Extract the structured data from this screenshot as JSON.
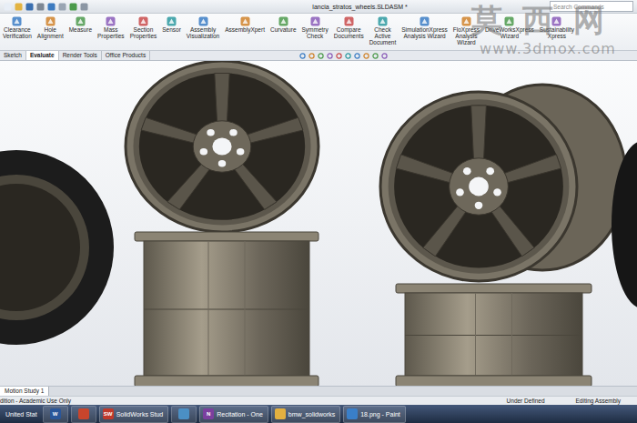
{
  "window": {
    "title": "lancia_stratos_wheels.SLDASM *"
  },
  "search": {
    "placeholder": "Search Commands"
  },
  "ribbon": [
    {
      "lines": [
        "Clearance",
        "Verification"
      ]
    },
    {
      "lines": [
        "Hole",
        "Alignment"
      ]
    },
    {
      "lines": [
        "Measure"
      ]
    },
    {
      "lines": [
        "Mass",
        "Properties"
      ]
    },
    {
      "lines": [
        "Section",
        "Properties"
      ]
    },
    {
      "lines": [
        "Sensor"
      ]
    },
    {
      "lines": [
        "Assembly",
        "Visualization"
      ]
    },
    {
      "lines": [
        "AssemblyXpert"
      ]
    },
    {
      "lines": [
        "Curvature"
      ]
    },
    {
      "lines": [
        "Symmetry",
        "Check"
      ]
    },
    {
      "lines": [
        "Compare",
        "Documents"
      ]
    },
    {
      "lines": [
        "Check",
        "Active",
        "Document"
      ]
    },
    {
      "lines": [
        "SimulationXpress",
        "Analysis Wizard"
      ]
    },
    {
      "lines": [
        "FloXpress",
        "Analysis",
        "Wizard"
      ]
    },
    {
      "lines": [
        "DriveWorksXpress",
        "Wizard"
      ]
    },
    {
      "lines": [
        "Sustainability",
        "Xpress"
      ]
    }
  ],
  "tabs": [
    {
      "label": "Sketch",
      "selected": false
    },
    {
      "label": "Evaluate",
      "selected": true
    },
    {
      "label": "Render Tools",
      "selected": false
    },
    {
      "label": "Office Products",
      "selected": false
    }
  ],
  "watermark": {
    "logo": "莫西网",
    "url": "www.3dmox.com"
  },
  "motion_tabs": [
    {
      "label": "Motion Study 1",
      "selected": true
    }
  ],
  "status_bar": {
    "left": "dition - Academic Use Only",
    "right": [
      "Under Defined",
      "Editing Assembly"
    ]
  },
  "taskbar": [
    {
      "kind": "lang",
      "label": "United Stat"
    },
    {
      "kind": "icon",
      "glyph": "W",
      "color": "#2a5699"
    },
    {
      "kind": "icon",
      "color": "#c8452c"
    },
    {
      "kind": "app",
      "glyph": "SW",
      "label": "SolidWorks Stud",
      "color": "#c0392b"
    },
    {
      "kind": "icon",
      "color": "#4b8fc4"
    },
    {
      "kind": "app",
      "glyph": "N",
      "label": "Recitation - One",
      "color": "#7b3f9e"
    },
    {
      "kind": "app",
      "label": "bmw_solidworks",
      "color": "#e2b040"
    },
    {
      "kind": "app",
      "label": "18.png - Paint",
      "color": "#3a7fc8"
    }
  ]
}
